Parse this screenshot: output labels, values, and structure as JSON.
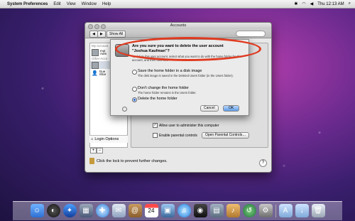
{
  "menubar": {
    "app": "System Preferences",
    "items": [
      "Edit",
      "View",
      "Window",
      "Help"
    ],
    "clock": "Thu 12:13 AM"
  },
  "window": {
    "title": "Accounts",
    "show_all": "Show All",
    "sidebar": {
      "my_account_header": "My Account",
      "my_account_name": "mut",
      "my_account_role": "Adm",
      "other_accounts_header": "Other Acco",
      "guest_label": "Gue",
      "guest_sub": "Shar",
      "login_options": "Login Options",
      "plus": "+",
      "minus": "−"
    },
    "allow_admin": "Allow user to administer this computer",
    "parental_controls": "Enable parental controls",
    "open_parental": "Open Parental Controls…",
    "lock_text": "Click the lock to prevent further changes.",
    "help": "?"
  },
  "dialog": {
    "question_line1": "Are you sure you want to delete the user account",
    "question_line2": "\"Joshua Kaufman\"?",
    "info": "To delete this user account, select what you want to do with the home folder for this account, and then click OK.",
    "options": [
      {
        "label": "Save the home folder in a disk image",
        "sub": "The disk image is saved in the Deleted Users folder (in the Users folder).",
        "selected": false
      },
      {
        "label": "Don't change the home folder",
        "sub": "The home folder remains in the Users folder.",
        "selected": false
      },
      {
        "label": "Delete the home folder",
        "sub": "",
        "selected": true
      }
    ],
    "cancel": "Cancel",
    "ok": "OK"
  },
  "colors": {
    "highlight": "#e03a20",
    "ok_button": "#5b9be6"
  },
  "dock": {
    "icons": [
      "finder-icon",
      "dashboard-icon",
      "expose-icon",
      "safari-icon",
      "mail-icon",
      "address-book-icon",
      "ical-icon",
      "iphoto-icon",
      "itunes-icon",
      "photo-booth-icon",
      "preview-icon",
      "garageband-icon",
      "time-machine-icon",
      "system-preferences-icon",
      "applications-folder-icon",
      "downloads-folder-icon",
      "trash-icon"
    ]
  }
}
